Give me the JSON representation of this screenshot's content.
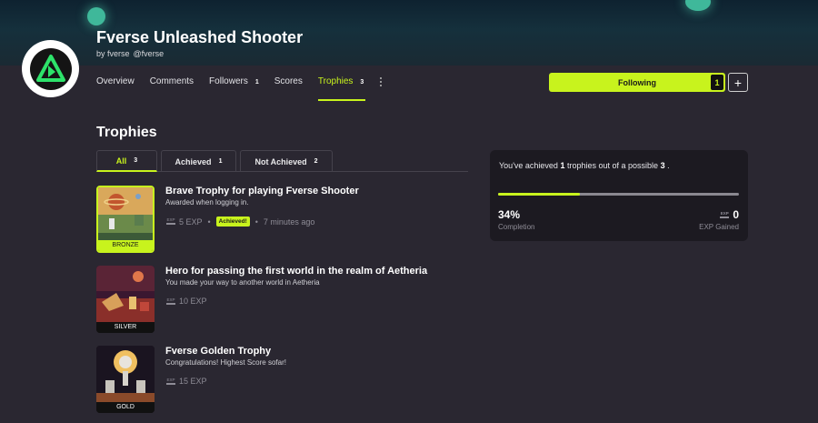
{
  "header": {
    "title": "Fverse Unleashed Shooter",
    "by_prefix": "by",
    "author": "fverse",
    "handle": "@fverse"
  },
  "nav": {
    "tabs": [
      {
        "label": "Overview",
        "count": null
      },
      {
        "label": "Comments",
        "count": null
      },
      {
        "label": "Followers",
        "count": "1"
      },
      {
        "label": "Scores",
        "count": null
      },
      {
        "label": "Trophies",
        "count": "3"
      }
    ],
    "active": "Trophies",
    "more_icon": "vertical-dots-icon"
  },
  "follow": {
    "label": "Following",
    "count": "1",
    "plus": "+"
  },
  "section": {
    "title": "Trophies"
  },
  "filters": [
    {
      "label": "All",
      "count": "3"
    },
    {
      "label": "Achieved",
      "count": "1"
    },
    {
      "label": "Not Achieved",
      "count": "2"
    }
  ],
  "trophies": [
    {
      "name": "Brave Trophy for playing Fverse Shooter",
      "description": "Awarded when logging in.",
      "exp": "5 EXP",
      "tier": "BRONZE",
      "badge": "Achieved!",
      "time": "7 minutes ago"
    },
    {
      "name": "Hero for passing the first world in the realm of Aetheria",
      "description": "You made your way to another world in Aetheria",
      "exp": "10 EXP",
      "tier": "SILVER"
    },
    {
      "name": "Fverse Golden Trophy",
      "description": "Congratulations! Highest Score sofar!",
      "exp": "15 EXP",
      "tier": "GOLD"
    }
  ],
  "summary": {
    "text_1": "You've achieved",
    "achieved": "1",
    "text_2": "trophies out of a possible",
    "total": "3",
    "text_3": ".",
    "progress": 0.34,
    "percent": "34%",
    "percent_label": "Completion",
    "exp_value": "0",
    "exp_label": "EXP Gained",
    "exp_icon_text": "EXP"
  },
  "colors": {
    "accent": "#c8f31d",
    "background": "#2a2731",
    "card": "#1c1a21"
  }
}
